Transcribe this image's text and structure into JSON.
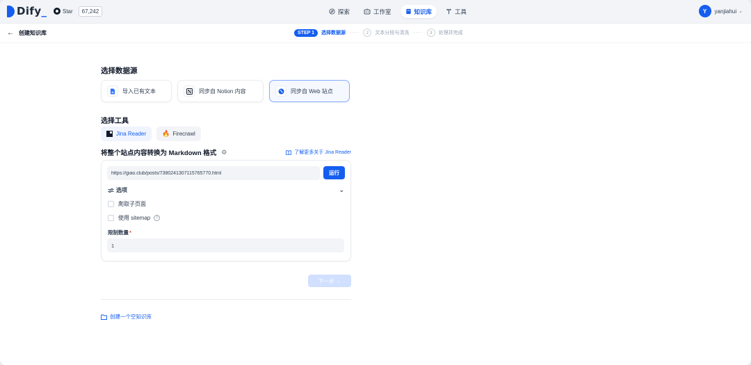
{
  "app": {
    "brand": "Dify",
    "brand_suffix": "_",
    "github": {
      "star_label": "Star",
      "star_count": "67,242"
    }
  },
  "nav": {
    "items": [
      {
        "label": "探索",
        "icon": "explore-icon"
      },
      {
        "label": "工作室",
        "icon": "studio-icon"
      },
      {
        "label": "知识库",
        "icon": "knowledge-icon",
        "active": true
      },
      {
        "label": "工具",
        "icon": "tools-icon"
      }
    ]
  },
  "user": {
    "initial": "Y",
    "name": "yanjiahui"
  },
  "page": {
    "back_label": "创建知识库",
    "steps": [
      {
        "badge": "STEP 1",
        "label": "选择数据源",
        "active": true
      },
      {
        "number": "2",
        "label": "文本分段与清洗"
      },
      {
        "number": "3",
        "label": "处理并完成"
      }
    ]
  },
  "datasource": {
    "title": "选择数据源",
    "options": [
      {
        "label": "导入已有文本",
        "icon": "file-text-icon"
      },
      {
        "label": "同步自 Notion 内容",
        "icon": "notion-icon"
      },
      {
        "label": "同步自 Web 站点",
        "icon": "globe-icon",
        "selected": true
      }
    ]
  },
  "tool_select": {
    "title": "选择工具",
    "tools": [
      {
        "label": "Jina Reader",
        "icon": "jina-icon",
        "selected": true
      },
      {
        "label": "Firecrawl",
        "icon": "fire-icon"
      }
    ]
  },
  "crawler": {
    "title": "将整个站点内容转换为 Markdown 格式",
    "learn_more": "了解更多关于 Jina Reader",
    "url_value": "https://giao.club/posts/7380241307115765770.html",
    "run_label": "运行",
    "options_label": "选项",
    "crawl_subpages_label": "爬取子页面",
    "use_sitemap_label": "使用 sitemap",
    "limit_label": "限制数量",
    "limit_required": "*",
    "limit_value": "1"
  },
  "footer": {
    "next_label": "下一步 →",
    "create_empty_label": "创建一个空知识库"
  },
  "colors": {
    "accent": "#155eef",
    "page_bg": "#f2f4f7"
  }
}
